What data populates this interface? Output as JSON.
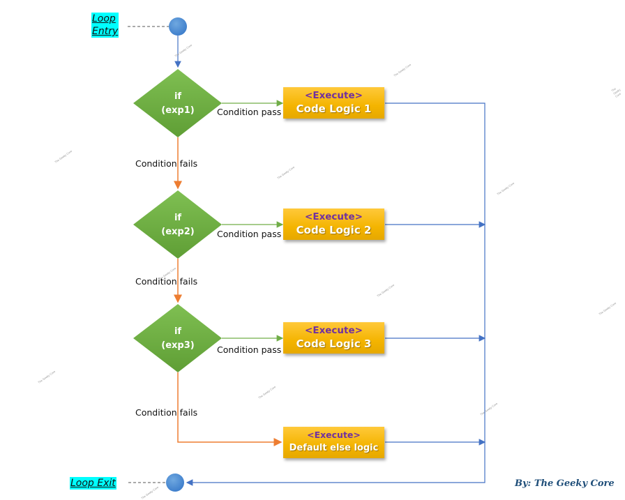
{
  "entry": {
    "label_line1": "Loop",
    "label_line2": "Entry"
  },
  "exit": {
    "label": "Loop Exit"
  },
  "conditions": [
    {
      "line1": "if",
      "line2": "(exp1)",
      "pass_label": "Condition pass",
      "fail_label": "Condition fails"
    },
    {
      "line1": "if",
      "line2": "(exp2)",
      "pass_label": "Condition pass",
      "fail_label": "Condition fails"
    },
    {
      "line1": "if",
      "line2": "(exp3)",
      "pass_label": "Condition pass",
      "fail_label": "Condition fails"
    }
  ],
  "blocks": [
    {
      "title": "<Execute>",
      "body": "Code Logic 1"
    },
    {
      "title": "<Execute>",
      "body": "Code Logic 2"
    },
    {
      "title": "<Execute>",
      "body": "Code Logic 3"
    },
    {
      "title": "<Execute>",
      "body": "Default else logic"
    }
  ],
  "credit": "By: The Geeky Core",
  "watermark": "The Geeky Core",
  "colors": {
    "pass_arrow": "#70ad47",
    "fail_arrow": "#ed7d31",
    "flow_arrow": "#4472c4",
    "decision": "#70ad47",
    "process": "#ffc000",
    "node": "#5b9bd5",
    "tag_bg": "#00ffff"
  }
}
